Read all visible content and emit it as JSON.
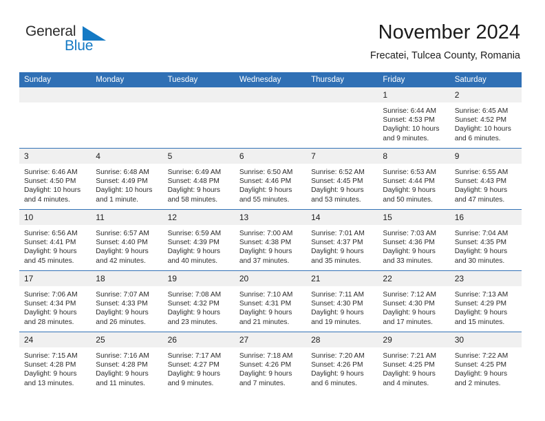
{
  "brand": {
    "name_top": "General",
    "name_bottom": "Blue",
    "accent_color": "#1479c4"
  },
  "header": {
    "title": "November 2024",
    "subtitle": "Frecatei, Tulcea County, Romania"
  },
  "theme": {
    "header_blue": "#3070b5",
    "daynum_bg": "#f0f0f0",
    "text": "#2a2a2a"
  },
  "labels": {
    "sunrise": "Sunrise:",
    "sunset": "Sunset:",
    "daylight": "Daylight:"
  },
  "weekdays": [
    "Sunday",
    "Monday",
    "Tuesday",
    "Wednesday",
    "Thursday",
    "Friday",
    "Saturday"
  ],
  "weeks": [
    [
      {
        "day": ""
      },
      {
        "day": ""
      },
      {
        "day": ""
      },
      {
        "day": ""
      },
      {
        "day": ""
      },
      {
        "day": "1",
        "sunrise": "Sunrise: 6:44 AM",
        "sunset": "Sunset: 4:53 PM",
        "daylight": "Daylight: 10 hours and 9 minutes."
      },
      {
        "day": "2",
        "sunrise": "Sunrise: 6:45 AM",
        "sunset": "Sunset: 4:52 PM",
        "daylight": "Daylight: 10 hours and 6 minutes."
      }
    ],
    [
      {
        "day": "3",
        "sunrise": "Sunrise: 6:46 AM",
        "sunset": "Sunset: 4:50 PM",
        "daylight": "Daylight: 10 hours and 4 minutes."
      },
      {
        "day": "4",
        "sunrise": "Sunrise: 6:48 AM",
        "sunset": "Sunset: 4:49 PM",
        "daylight": "Daylight: 10 hours and 1 minute."
      },
      {
        "day": "5",
        "sunrise": "Sunrise: 6:49 AM",
        "sunset": "Sunset: 4:48 PM",
        "daylight": "Daylight: 9 hours and 58 minutes."
      },
      {
        "day": "6",
        "sunrise": "Sunrise: 6:50 AM",
        "sunset": "Sunset: 4:46 PM",
        "daylight": "Daylight: 9 hours and 55 minutes."
      },
      {
        "day": "7",
        "sunrise": "Sunrise: 6:52 AM",
        "sunset": "Sunset: 4:45 PM",
        "daylight": "Daylight: 9 hours and 53 minutes."
      },
      {
        "day": "8",
        "sunrise": "Sunrise: 6:53 AM",
        "sunset": "Sunset: 4:44 PM",
        "daylight": "Daylight: 9 hours and 50 minutes."
      },
      {
        "day": "9",
        "sunrise": "Sunrise: 6:55 AM",
        "sunset": "Sunset: 4:43 PM",
        "daylight": "Daylight: 9 hours and 47 minutes."
      }
    ],
    [
      {
        "day": "10",
        "sunrise": "Sunrise: 6:56 AM",
        "sunset": "Sunset: 4:41 PM",
        "daylight": "Daylight: 9 hours and 45 minutes."
      },
      {
        "day": "11",
        "sunrise": "Sunrise: 6:57 AM",
        "sunset": "Sunset: 4:40 PM",
        "daylight": "Daylight: 9 hours and 42 minutes."
      },
      {
        "day": "12",
        "sunrise": "Sunrise: 6:59 AM",
        "sunset": "Sunset: 4:39 PM",
        "daylight": "Daylight: 9 hours and 40 minutes."
      },
      {
        "day": "13",
        "sunrise": "Sunrise: 7:00 AM",
        "sunset": "Sunset: 4:38 PM",
        "daylight": "Daylight: 9 hours and 37 minutes."
      },
      {
        "day": "14",
        "sunrise": "Sunrise: 7:01 AM",
        "sunset": "Sunset: 4:37 PM",
        "daylight": "Daylight: 9 hours and 35 minutes."
      },
      {
        "day": "15",
        "sunrise": "Sunrise: 7:03 AM",
        "sunset": "Sunset: 4:36 PM",
        "daylight": "Daylight: 9 hours and 33 minutes."
      },
      {
        "day": "16",
        "sunrise": "Sunrise: 7:04 AM",
        "sunset": "Sunset: 4:35 PM",
        "daylight": "Daylight: 9 hours and 30 minutes."
      }
    ],
    [
      {
        "day": "17",
        "sunrise": "Sunrise: 7:06 AM",
        "sunset": "Sunset: 4:34 PM",
        "daylight": "Daylight: 9 hours and 28 minutes."
      },
      {
        "day": "18",
        "sunrise": "Sunrise: 7:07 AM",
        "sunset": "Sunset: 4:33 PM",
        "daylight": "Daylight: 9 hours and 26 minutes."
      },
      {
        "day": "19",
        "sunrise": "Sunrise: 7:08 AM",
        "sunset": "Sunset: 4:32 PM",
        "daylight": "Daylight: 9 hours and 23 minutes."
      },
      {
        "day": "20",
        "sunrise": "Sunrise: 7:10 AM",
        "sunset": "Sunset: 4:31 PM",
        "daylight": "Daylight: 9 hours and 21 minutes."
      },
      {
        "day": "21",
        "sunrise": "Sunrise: 7:11 AM",
        "sunset": "Sunset: 4:30 PM",
        "daylight": "Daylight: 9 hours and 19 minutes."
      },
      {
        "day": "22",
        "sunrise": "Sunrise: 7:12 AM",
        "sunset": "Sunset: 4:30 PM",
        "daylight": "Daylight: 9 hours and 17 minutes."
      },
      {
        "day": "23",
        "sunrise": "Sunrise: 7:13 AM",
        "sunset": "Sunset: 4:29 PM",
        "daylight": "Daylight: 9 hours and 15 minutes."
      }
    ],
    [
      {
        "day": "24",
        "sunrise": "Sunrise: 7:15 AM",
        "sunset": "Sunset: 4:28 PM",
        "daylight": "Daylight: 9 hours and 13 minutes."
      },
      {
        "day": "25",
        "sunrise": "Sunrise: 7:16 AM",
        "sunset": "Sunset: 4:28 PM",
        "daylight": "Daylight: 9 hours and 11 minutes."
      },
      {
        "day": "26",
        "sunrise": "Sunrise: 7:17 AM",
        "sunset": "Sunset: 4:27 PM",
        "daylight": "Daylight: 9 hours and 9 minutes."
      },
      {
        "day": "27",
        "sunrise": "Sunrise: 7:18 AM",
        "sunset": "Sunset: 4:26 PM",
        "daylight": "Daylight: 9 hours and 7 minutes."
      },
      {
        "day": "28",
        "sunrise": "Sunrise: 7:20 AM",
        "sunset": "Sunset: 4:26 PM",
        "daylight": "Daylight: 9 hours and 6 minutes."
      },
      {
        "day": "29",
        "sunrise": "Sunrise: 7:21 AM",
        "sunset": "Sunset: 4:25 PM",
        "daylight": "Daylight: 9 hours and 4 minutes."
      },
      {
        "day": "30",
        "sunrise": "Sunrise: 7:22 AM",
        "sunset": "Sunset: 4:25 PM",
        "daylight": "Daylight: 9 hours and 2 minutes."
      }
    ]
  ]
}
